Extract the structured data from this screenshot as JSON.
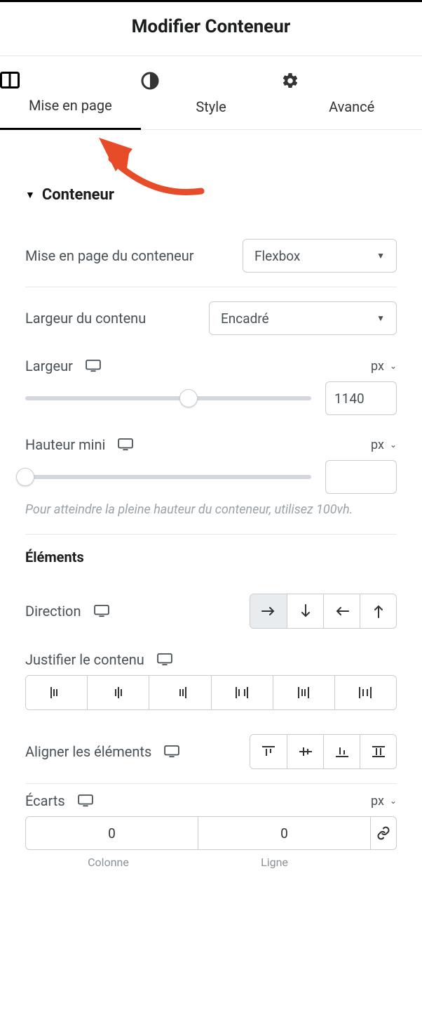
{
  "header": {
    "title": "Modifier Conteneur"
  },
  "tabs": {
    "layout": "Mise en page",
    "style": "Style",
    "advanced": "Avancé"
  },
  "section": {
    "title": "Conteneur"
  },
  "containerLayout": {
    "label": "Mise en page du conteneur",
    "value": "Flexbox"
  },
  "contentWidth": {
    "label": "Largeur du contenu",
    "value": "Encadré"
  },
  "width": {
    "label": "Largeur",
    "unit": "px",
    "value": "1140"
  },
  "minHeight": {
    "label": "Hauteur mini",
    "unit": "px",
    "value": "",
    "hint": "Pour atteindre la pleine hauteur du conteneur, utilisez 100vh."
  },
  "elements": {
    "heading": "Éléments"
  },
  "direction": {
    "label": "Direction"
  },
  "justify": {
    "label": "Justifier le contenu"
  },
  "align": {
    "label": "Aligner les éléments"
  },
  "gaps": {
    "label": "Écarts",
    "unit": "px",
    "column": "0",
    "row": "0",
    "columnLabel": "Colonne",
    "rowLabel": "Ligne"
  }
}
